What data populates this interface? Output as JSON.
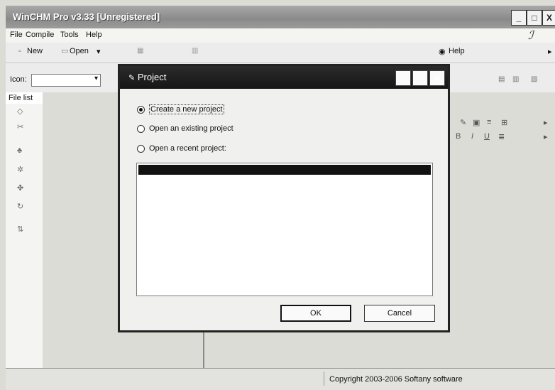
{
  "window": {
    "title": "WinCHM Pro v3.33 [Unregistered]",
    "min_label": "_",
    "max_label": "□",
    "close_label": "X"
  },
  "menu": [
    "File",
    "Compile",
    "Tools",
    "Help"
  ],
  "toolbar": {
    "new_label": "New",
    "open_label": "Open",
    "help_label": "Help",
    "icon_label": "Icon:",
    "icon_value": ""
  },
  "left_tab": "File list",
  "status": {
    "copyright": "Copyright 2003-2006 Softany software"
  },
  "dialog": {
    "title": "Project",
    "options": [
      {
        "label": "Create a new project",
        "selected": true
      },
      {
        "label": "Open an existing project",
        "selected": false
      },
      {
        "label": "Open a recent project:",
        "selected": false
      }
    ],
    "ok_label": "OK",
    "cancel_label": "Cancel"
  },
  "colors": {
    "dialog_titlebar": "#1e1e1e",
    "main_titlebar": "#9a9a9a",
    "selection": "#111111"
  }
}
